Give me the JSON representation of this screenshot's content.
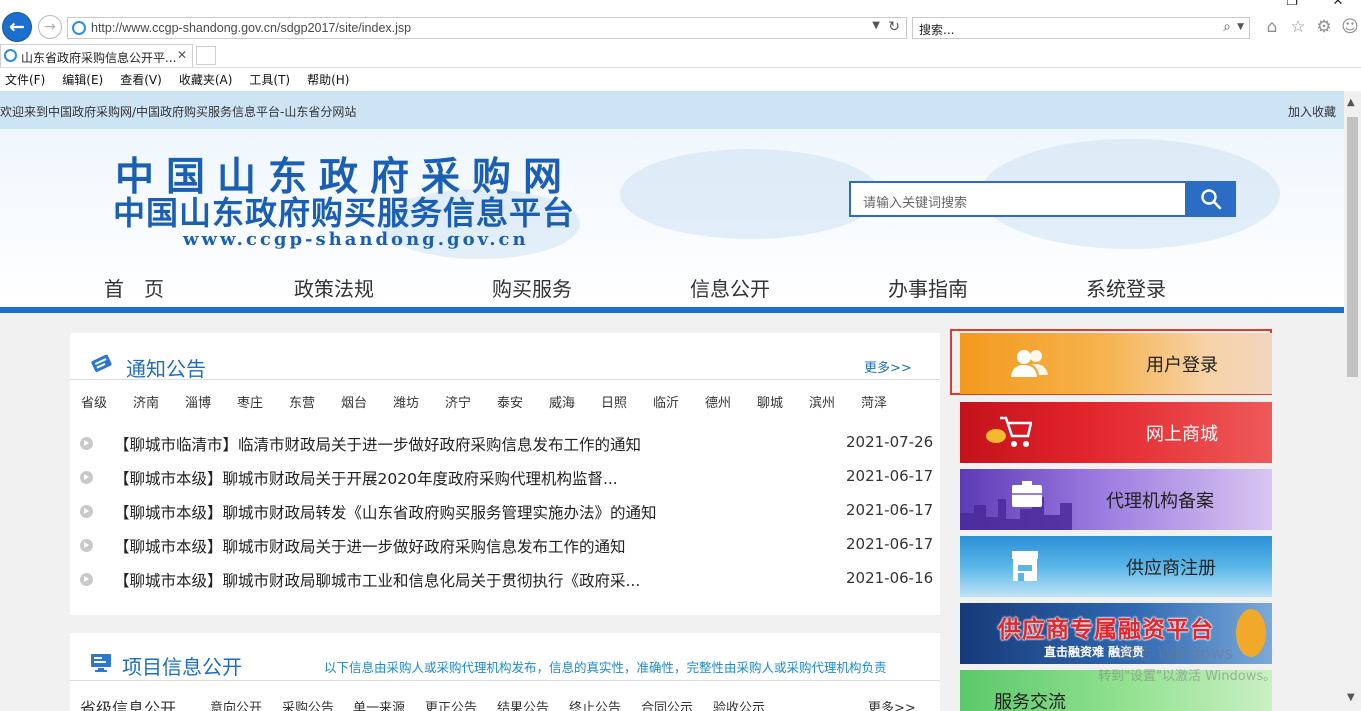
{
  "browser": {
    "url": "http://www.ccgp-shandong.gov.cn/sdgp2017/site/index.jsp",
    "search_placeholder": "搜索...",
    "tab_title": "山东省政府采购信息公开平...",
    "menu": [
      "文件(F)",
      "编辑(E)",
      "查看(V)",
      "收藏夹(A)",
      "工具(T)",
      "帮助(H)"
    ]
  },
  "topbar": {
    "welcome": "欢迎来到中国政府采购网/中国政府购买服务信息平台-山东省分网站",
    "favorite": "加入收藏"
  },
  "header": {
    "logo_line1": "中国山东政府采购网",
    "logo_line2": "中国山东政府购买服务信息平台",
    "logo_url": "www.ccgp-shandong.gov.cn",
    "search_placeholder": "请输入关键词搜索"
  },
  "nav": [
    "首　页",
    "政策法规",
    "购买服务",
    "信息公开",
    "办事指南",
    "系统登录"
  ],
  "notice": {
    "title": "通知公告",
    "more": "更多>>",
    "cities": [
      "省级",
      "济南",
      "淄博",
      "枣庄",
      "东营",
      "烟台",
      "潍坊",
      "济宁",
      "泰安",
      "威海",
      "日照",
      "临沂",
      "德州",
      "聊城",
      "滨州",
      "菏泽"
    ],
    "items": [
      {
        "text": "【聊城市临清市】临清市财政局关于进一步做好政府采购信息发布工作的通知",
        "date": "2021-07-26"
      },
      {
        "text": "【聊城市本级】聊城市财政局关于开展2020年度政府采购代理机构监督...",
        "date": "2021-06-17"
      },
      {
        "text": "【聊城市本级】聊城市财政局转发《山东省政府购买服务管理实施办法》的通知",
        "date": "2021-06-17"
      },
      {
        "text": "【聊城市本级】聊城市财政局关于进一步做好政府采购信息发布工作的通知",
        "date": "2021-06-17"
      },
      {
        "text": "【聊城市本级】聊城市财政局聊城市工业和信息化局关于贯彻执行《政府采...",
        "date": "2021-06-16"
      }
    ]
  },
  "project": {
    "title": "项目信息公开",
    "desc": "以下信息由采购人或采购代理机构发布，信息的真实性，准确性，完整性由采购人或采购代理机构负责",
    "tabs": [
      "省级信息公开",
      "意向公开",
      "采购公告",
      "单一来源",
      "更正公告",
      "结果公告",
      "终止公告",
      "合同公示",
      "验收公示"
    ],
    "more": "更多>>"
  },
  "sidebar": [
    {
      "label": "用户登录"
    },
    {
      "label": "网上商城"
    },
    {
      "label": "代理机构备案"
    },
    {
      "label": "供应商注册"
    },
    {
      "label": "供应商专属融资平台",
      "sub": "直击融资难 融资贵"
    },
    {
      "label": "服务交流"
    }
  ],
  "overlay": {
    "line1": "激活 Windows",
    "line2": "转到\"设置\"以激活 Windows。"
  },
  "colors": {
    "brand_blue": "#1a6ec8",
    "nav_line": "#1b6fcf",
    "highlight_border": "#e03a2e"
  }
}
